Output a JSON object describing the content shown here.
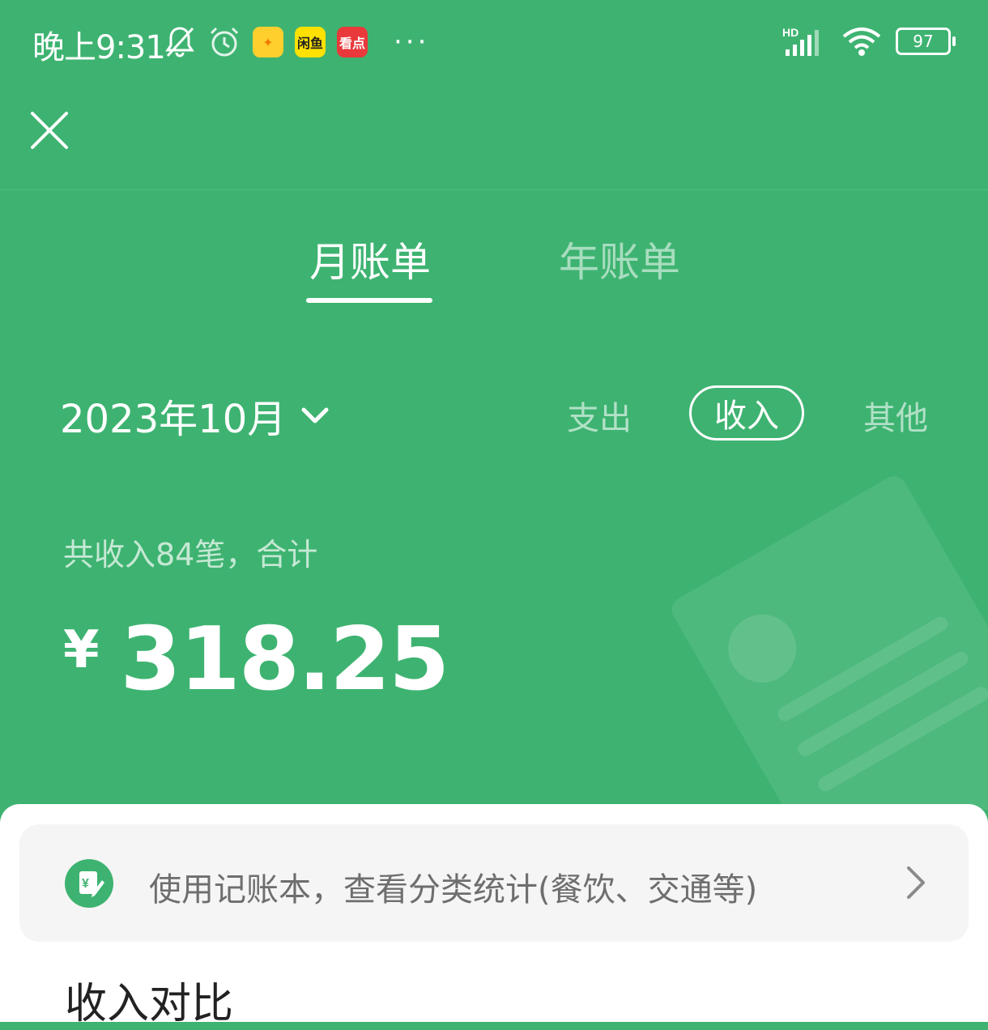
{
  "status_bar": {
    "time": "晚上9:31",
    "app_icons": [
      {
        "name": "pets-app",
        "label": ""
      },
      {
        "name": "xianyu-app",
        "label": "闲鱼"
      },
      {
        "name": "kandian-app",
        "label": "看点"
      }
    ],
    "more": "···",
    "network": "HD",
    "battery": "97"
  },
  "tabs": [
    {
      "label": "月账单",
      "active": true
    },
    {
      "label": "年账单",
      "active": false
    }
  ],
  "filter": {
    "date": "2023年10月",
    "types": [
      {
        "label": "支出",
        "selected": false
      },
      {
        "label": "收入",
        "selected": true
      },
      {
        "label": "其他",
        "selected": false
      }
    ]
  },
  "summary": {
    "text": "共收入84笔，合计",
    "currency": "¥",
    "amount": "318.25"
  },
  "promo": {
    "text": "使用记账本，查看分类统计(餐饮、交通等)"
  },
  "section": {
    "title": "收入对比"
  },
  "colors": {
    "brand_green": "#3eb371",
    "sheet_bg": "#ffffff",
    "promo_bg": "#f5f5f5",
    "promo_text": "#6e6e6e"
  }
}
